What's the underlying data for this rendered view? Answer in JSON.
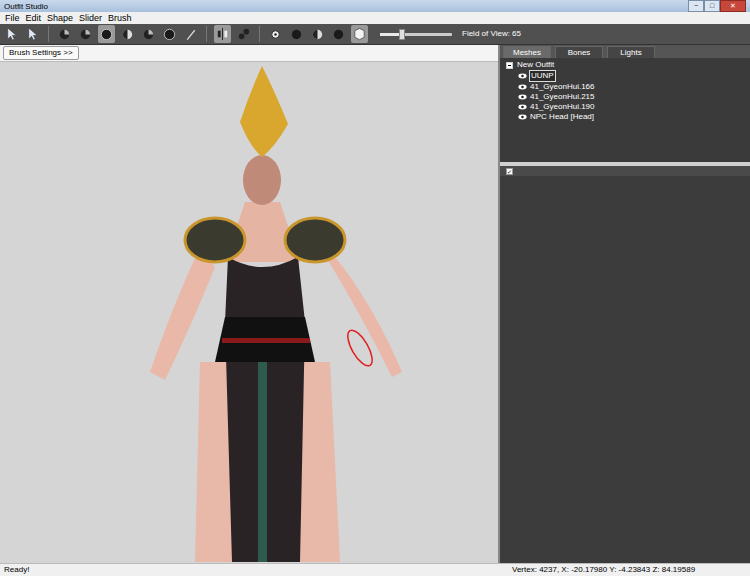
{
  "window": {
    "title": "Outfit Studio",
    "controls": [
      "−",
      "□",
      "✕"
    ]
  },
  "menu": [
    "File",
    "Edit",
    "Shape",
    "Slider",
    "Brush"
  ],
  "toolbar": {
    "tools": [
      {
        "kind": "pointer",
        "selected": false
      },
      {
        "kind": "pointer",
        "selected": false
      },
      {
        "kind": "sep",
        "selected": false
      },
      {
        "kind": "brush",
        "selected": false
      },
      {
        "kind": "brush",
        "selected": false
      },
      {
        "kind": "sphere",
        "selected": true
      },
      {
        "kind": "half",
        "selected": false
      },
      {
        "kind": "brush",
        "selected": false
      },
      {
        "kind": "sphere",
        "selected": false
      },
      {
        "kind": "pen",
        "selected": false
      },
      {
        "kind": "sep",
        "selected": false
      },
      {
        "kind": "mirror",
        "selected": true
      },
      {
        "kind": "link",
        "selected": false
      },
      {
        "kind": "sep",
        "selected": false
      },
      {
        "kind": "view",
        "selected": false
      },
      {
        "kind": "dot",
        "selected": false
      },
      {
        "kind": "half",
        "selected": false
      },
      {
        "kind": "dot",
        "selected": false
      },
      {
        "kind": "cube",
        "selected": true
      }
    ],
    "fov": {
      "label": "Field of View: 65",
      "level": 0.3
    }
  },
  "viewport": {
    "brush_settings": "Brush Settings >>"
  },
  "panel": {
    "tabs": [
      {
        "label": "Meshes",
        "selected": true
      },
      {
        "label": "Bones",
        "selected": false
      },
      {
        "label": "Lights",
        "selected": false
      }
    ],
    "tree": {
      "root": {
        "label": "New Outfit",
        "expanded": true
      },
      "items": [
        {
          "label": "UUNP",
          "visible": true,
          "selected": true
        },
        {
          "label": "41_GyeonHui.166",
          "visible": true,
          "selected": false
        },
        {
          "label": "41_GyeonHui.215",
          "visible": true,
          "selected": false
        },
        {
          "label": "41_GyeonHui.190",
          "visible": true,
          "selected": false
        },
        {
          "label": "NPC Head [Head]",
          "visible": true,
          "selected": false
        }
      ]
    },
    "lower": {
      "checked": true,
      "tick": "✓"
    }
  },
  "status_bar": {
    "left": "Ready!",
    "right": "Vertex: 4237, X: -20.17980 Y: -4.23843 Z: 84.19589"
  }
}
